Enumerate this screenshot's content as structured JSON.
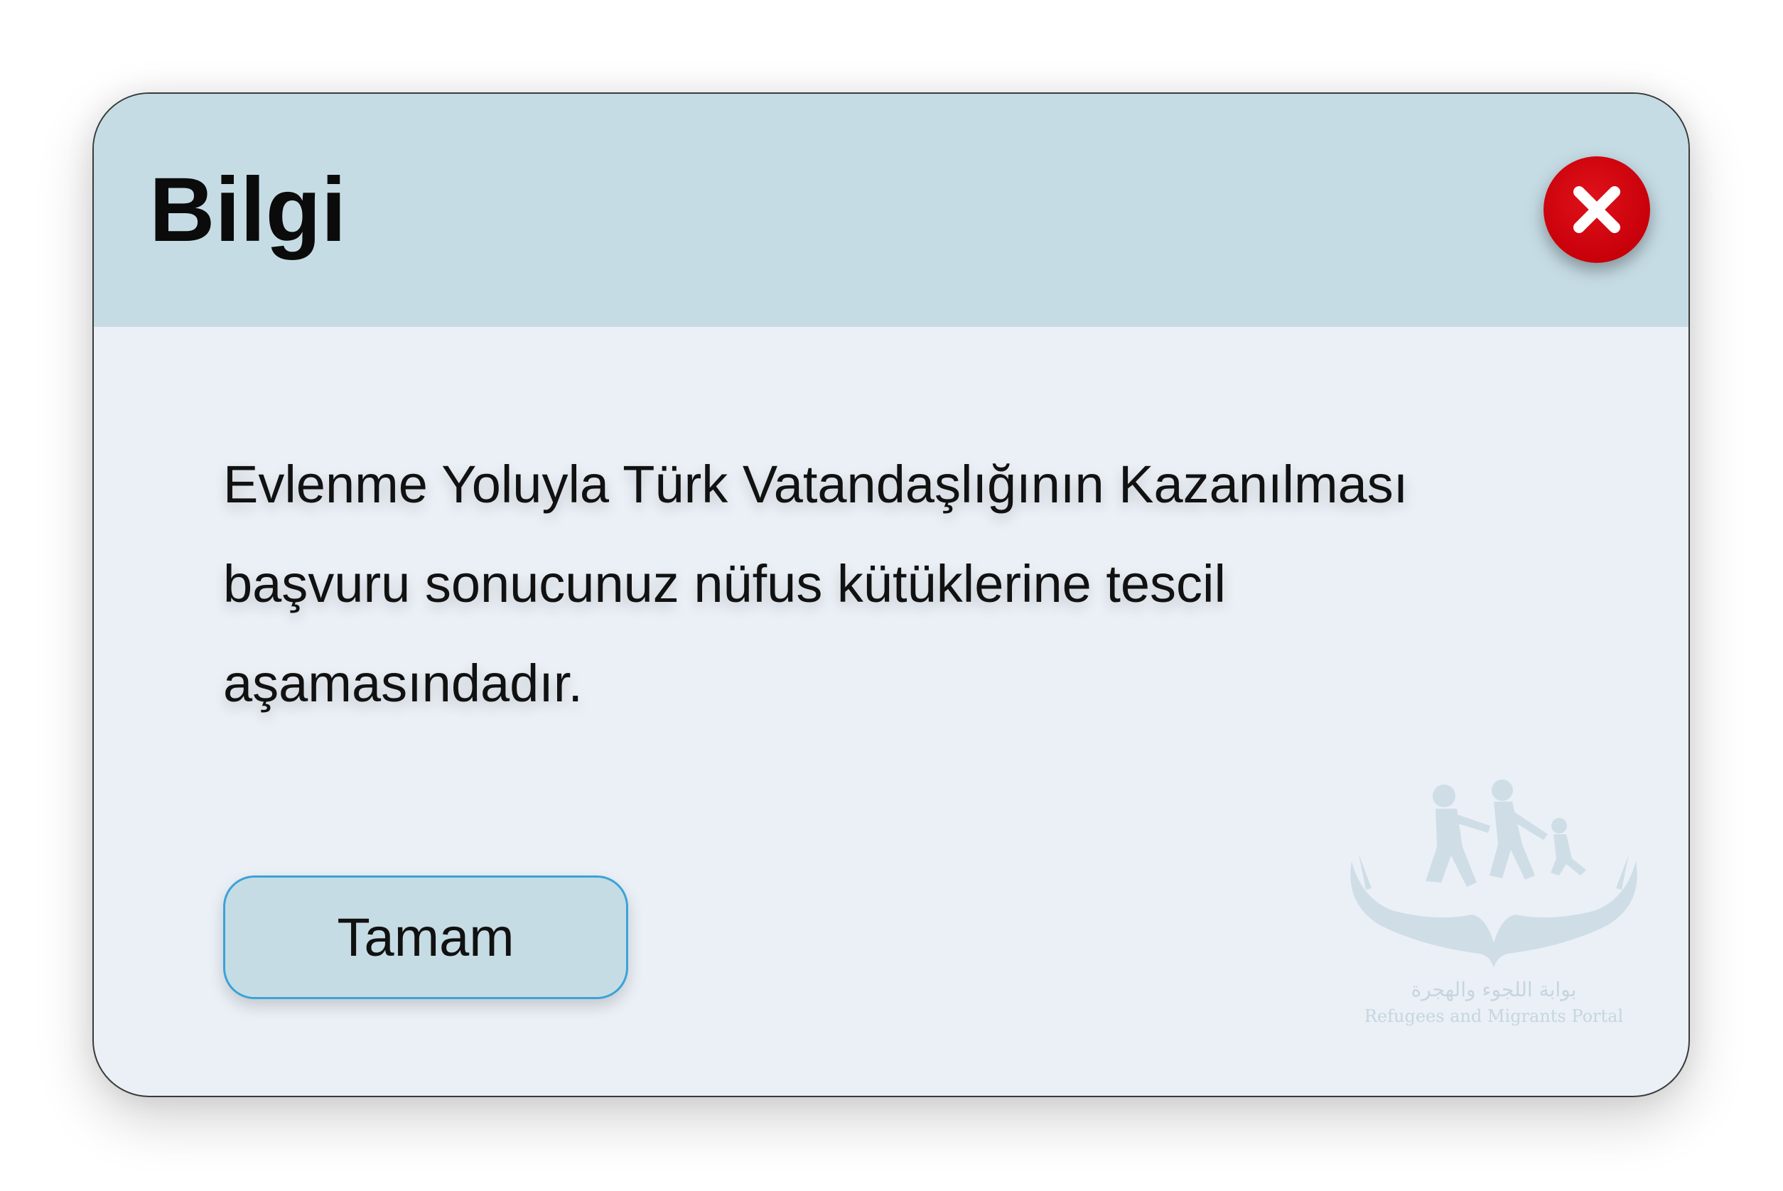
{
  "dialog": {
    "title": "Bilgi",
    "message": "Evlenme Yoluyla Türk Vatandaşlığının Kazanılması başvuru sonucunuz nüfus kütüklerine tescil aşamasındadır.",
    "ok_label": "Tamam",
    "close_icon": "close-icon"
  },
  "watermark": {
    "arabic_text": "بوابة اللجوء والهجرة",
    "english_text": "Refugees and Migrants Portal"
  },
  "colors": {
    "header_bg": "#c6dce5",
    "body_bg": "#eaf0f6",
    "close_red": "#c8000a",
    "button_border": "#3aa3d8"
  }
}
